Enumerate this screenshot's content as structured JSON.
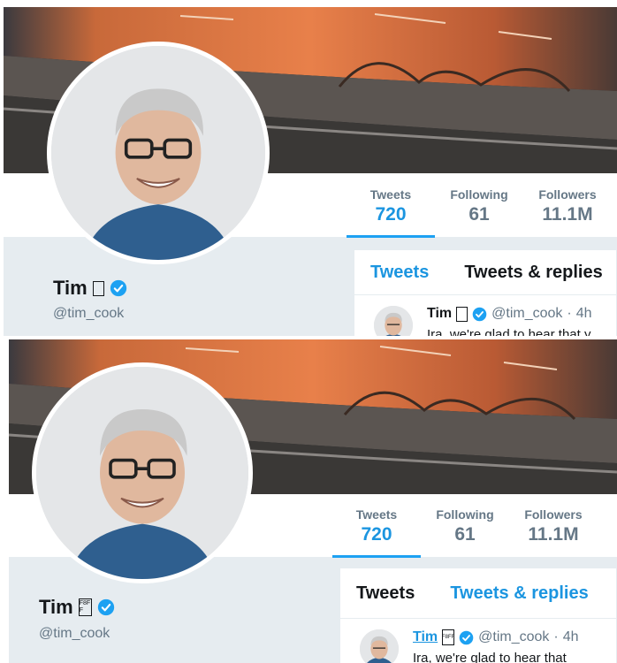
{
  "panels": [
    {
      "profile": {
        "name": "Tim",
        "special_glyph": "",
        "handle": "@tim_cook"
      },
      "stats": [
        {
          "label": "Tweets",
          "value": "720",
          "active": true
        },
        {
          "label": "Following",
          "value": "61",
          "active": false
        },
        {
          "label": "Followers",
          "value": "11.1M",
          "active": false
        }
      ],
      "tabs": [
        {
          "label": "Tweets",
          "active": true
        },
        {
          "label": "Tweets & replies",
          "active": false
        }
      ],
      "tweet": {
        "name": "Tim",
        "special_glyph": "",
        "handle": "@tim_cook",
        "separator": "·",
        "time": "4h",
        "text": "Ira, we're glad to hear that y"
      }
    },
    {
      "profile": {
        "name": "Tim",
        "special_glyph": "F8FF",
        "handle": "@tim_cook"
      },
      "stats": [
        {
          "label": "Tweets",
          "value": "720",
          "active": true
        },
        {
          "label": "Following",
          "value": "61",
          "active": false
        },
        {
          "label": "Followers",
          "value": "11.1M",
          "active": false
        }
      ],
      "tabs": [
        {
          "label": "Tweets",
          "active": false
        },
        {
          "label": "Tweets & replies",
          "active": true
        }
      ],
      "tweet": {
        "name": "Tim",
        "special_glyph": "F8FF",
        "handle": "@tim_cook",
        "separator": "·",
        "time": "4h",
        "text": "Ira, we're glad to hear that"
      }
    }
  ],
  "icons": {
    "verified": "verified-badge-icon",
    "avatar": "profile-photo"
  },
  "colors": {
    "accent": "#1da1f2",
    "link": "#1b95e0",
    "muted": "#657786",
    "background_gray": "#e6ecf0"
  }
}
